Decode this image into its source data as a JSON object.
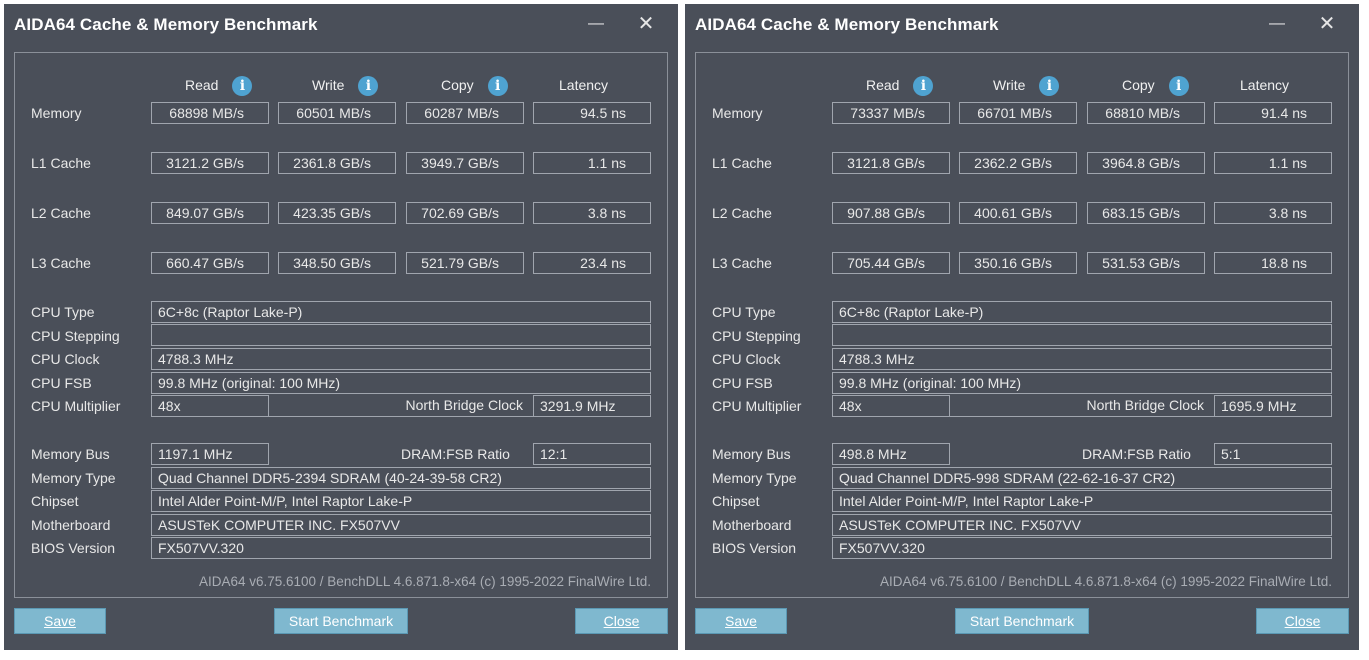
{
  "windows": [
    {
      "title": "AIDA64 Cache & Memory Benchmark",
      "window_controls": {
        "minimize": "—",
        "close": "✕"
      },
      "columns": {
        "read": "Read",
        "write": "Write",
        "copy": "Copy",
        "latency": "Latency"
      },
      "info_icon": "i",
      "rows": [
        {
          "label": "Memory",
          "read": "68898 MB/s",
          "write": "60501 MB/s",
          "copy": "60287 MB/s",
          "latency": "94.5 ns"
        },
        {
          "label": "L1 Cache",
          "read": "3121.2 GB/s",
          "write": "2361.8 GB/s",
          "copy": "3949.7 GB/s",
          "latency": "1.1 ns"
        },
        {
          "label": "L2 Cache",
          "read": "849.07 GB/s",
          "write": "423.35 GB/s",
          "copy": "702.69 GB/s",
          "latency": "3.8 ns"
        },
        {
          "label": "L3 Cache",
          "read": "660.47 GB/s",
          "write": "348.50 GB/s",
          "copy": "521.79 GB/s",
          "latency": "23.4 ns"
        }
      ],
      "cpu": {
        "type_label": "CPU Type",
        "type": "6C+8c   (Raptor Lake-P)",
        "stepping_label": "CPU Stepping",
        "stepping": "",
        "clock_label": "CPU Clock",
        "clock": "4788.3 MHz",
        "fsb_label": "CPU FSB",
        "fsb": "99.8 MHz  (original: 100 MHz)",
        "multiplier_label": "CPU Multiplier",
        "multiplier": "48x",
        "nb_clock_label": "North Bridge Clock",
        "nb_clock": "3291.9 MHz"
      },
      "memory": {
        "bus_label": "Memory Bus",
        "bus": "1197.1 MHz",
        "ratio_label": "DRAM:FSB Ratio",
        "ratio": "12:1",
        "type_label": "Memory Type",
        "type": "Quad Channel DDR5-2394 SDRAM  (40-24-39-58 CR2)",
        "chipset_label": "Chipset",
        "chipset": "Intel Alder Point-M/P, Intel Raptor Lake-P",
        "motherboard_label": "Motherboard",
        "motherboard": "ASUSTeK COMPUTER INC. FX507VV",
        "bios_label": "BIOS Version",
        "bios": "FX507VV.320"
      },
      "footer": "AIDA64 v6.75.6100 / BenchDLL 4.6.871.8-x64  (c) 1995-2022 FinalWire Ltd.",
      "buttons": {
        "save": "Save",
        "start": "Start Benchmark",
        "close": "Close"
      }
    },
    {
      "title": "AIDA64 Cache & Memory Benchmark",
      "window_controls": {
        "minimize": "—",
        "close": "✕"
      },
      "columns": {
        "read": "Read",
        "write": "Write",
        "copy": "Copy",
        "latency": "Latency"
      },
      "info_icon": "i",
      "rows": [
        {
          "label": "Memory",
          "read": "73337 MB/s",
          "write": "66701 MB/s",
          "copy": "68810 MB/s",
          "latency": "91.4 ns"
        },
        {
          "label": "L1 Cache",
          "read": "3121.8 GB/s",
          "write": "2362.2 GB/s",
          "copy": "3964.8 GB/s",
          "latency": "1.1 ns"
        },
        {
          "label": "L2 Cache",
          "read": "907.88 GB/s",
          "write": "400.61 GB/s",
          "copy": "683.15 GB/s",
          "latency": "3.8 ns"
        },
        {
          "label": "L3 Cache",
          "read": "705.44 GB/s",
          "write": "350.16 GB/s",
          "copy": "531.53 GB/s",
          "latency": "18.8 ns"
        }
      ],
      "cpu": {
        "type_label": "CPU Type",
        "type": "6C+8c   (Raptor Lake-P)",
        "stepping_label": "CPU Stepping",
        "stepping": "",
        "clock_label": "CPU Clock",
        "clock": "4788.3 MHz",
        "fsb_label": "CPU FSB",
        "fsb": "99.8 MHz  (original: 100 MHz)",
        "multiplier_label": "CPU Multiplier",
        "multiplier": "48x",
        "nb_clock_label": "North Bridge Clock",
        "nb_clock": "1695.9 MHz"
      },
      "memory": {
        "bus_label": "Memory Bus",
        "bus": "498.8 MHz",
        "ratio_label": "DRAM:FSB Ratio",
        "ratio": "5:1",
        "type_label": "Memory Type",
        "type": "Quad Channel DDR5-998 SDRAM  (22-62-16-37 CR2)",
        "chipset_label": "Chipset",
        "chipset": "Intel Alder Point-M/P, Intel Raptor Lake-P",
        "motherboard_label": "Motherboard",
        "motherboard": "ASUSTeK COMPUTER INC. FX507VV",
        "bios_label": "BIOS Version",
        "bios": "FX507VV.320"
      },
      "footer": "AIDA64 v6.75.6100 / BenchDLL 4.6.871.8-x64  (c) 1995-2022 FinalWire Ltd.",
      "buttons": {
        "save": "Save",
        "start": "Start Benchmark",
        "close": "Close"
      }
    }
  ]
}
